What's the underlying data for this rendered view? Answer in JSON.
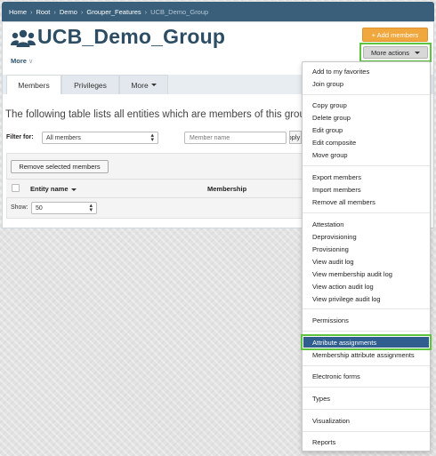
{
  "breadcrumb": {
    "items": [
      "Home",
      "Root",
      "Demo",
      "Grouper_Features"
    ],
    "current": "UCB_Demo_Group",
    "separator": "›"
  },
  "header": {
    "title": "UCB_Demo_Group",
    "icon": "group-icon",
    "more_label": "More",
    "more_caret": "∨",
    "add_members_label": "+ Add members",
    "more_actions_label": "More actions"
  },
  "tabs": [
    {
      "label": "Members"
    },
    {
      "label": "Privileges"
    },
    {
      "label": "More"
    }
  ],
  "main": {
    "intro": "The following table lists all entities which are members of this group.",
    "filter_label": "Filter for:",
    "filter_value": "All members",
    "member_placeholder": "Member name",
    "apply_button": "Apply filter",
    "remove_button": "Remove selected members",
    "columns": [
      "Entity name",
      "Membership"
    ],
    "show_label": "Show:",
    "show_value": "50"
  },
  "menu": {
    "items": [
      "Add to my favorites",
      "Join group",
      "Copy group",
      "Delete group",
      "Edit group",
      "Edit composite",
      "Move group",
      "Export members",
      "Import members",
      "Remove all members",
      "Attestation",
      "Deprovisioning",
      "Provisioning",
      "View audit log",
      "View membership audit log",
      "View action audit log",
      "View privilege audit log",
      "Permissions",
      "Attribute assignments",
      "Membership attribute assignments",
      "Electronic forms",
      "Types",
      "Visualization",
      "Reports"
    ],
    "highlighted": "Attribute assignments"
  },
  "colors": {
    "breadcrumb_bg": "#3a5f7a",
    "title": "#2c4d63",
    "add_button": "#f0a73d",
    "highlight_outline": "#5ec440",
    "menu_selected": "#2f5e8f"
  }
}
